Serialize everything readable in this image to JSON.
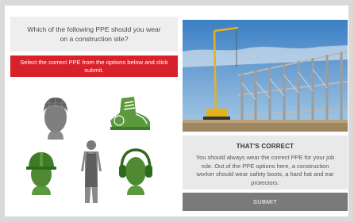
{
  "question": {
    "text": "Which of the following PPE should you wear on a construction site?"
  },
  "instruction": {
    "text": "Select the correct PPE from the options below and click submit."
  },
  "options": [
    {
      "icon": "hair-net-head-icon",
      "selected": false
    },
    {
      "icon": "safety-boot-icon",
      "selected": true
    },
    {
      "icon": "hard-hat-icon",
      "selected": true
    },
    {
      "icon": "apron-icon",
      "selected": false
    },
    {
      "icon": "ear-protectors-icon",
      "selected": true
    }
  ],
  "feedback": {
    "title": "THAT'S CORRECT",
    "body": "You should always wear the correct PPE for your job role. Out of the PPE options here, a construction worker should wear safety boots, a hard hat and ear protectors."
  },
  "submit": {
    "label": "SUBMIT"
  },
  "colors": {
    "accent_red": "#d9212a",
    "selected_green": "#5a9a3c",
    "unselected_gray": "#8a8a8a",
    "submit_gray": "#7a7a7a"
  }
}
